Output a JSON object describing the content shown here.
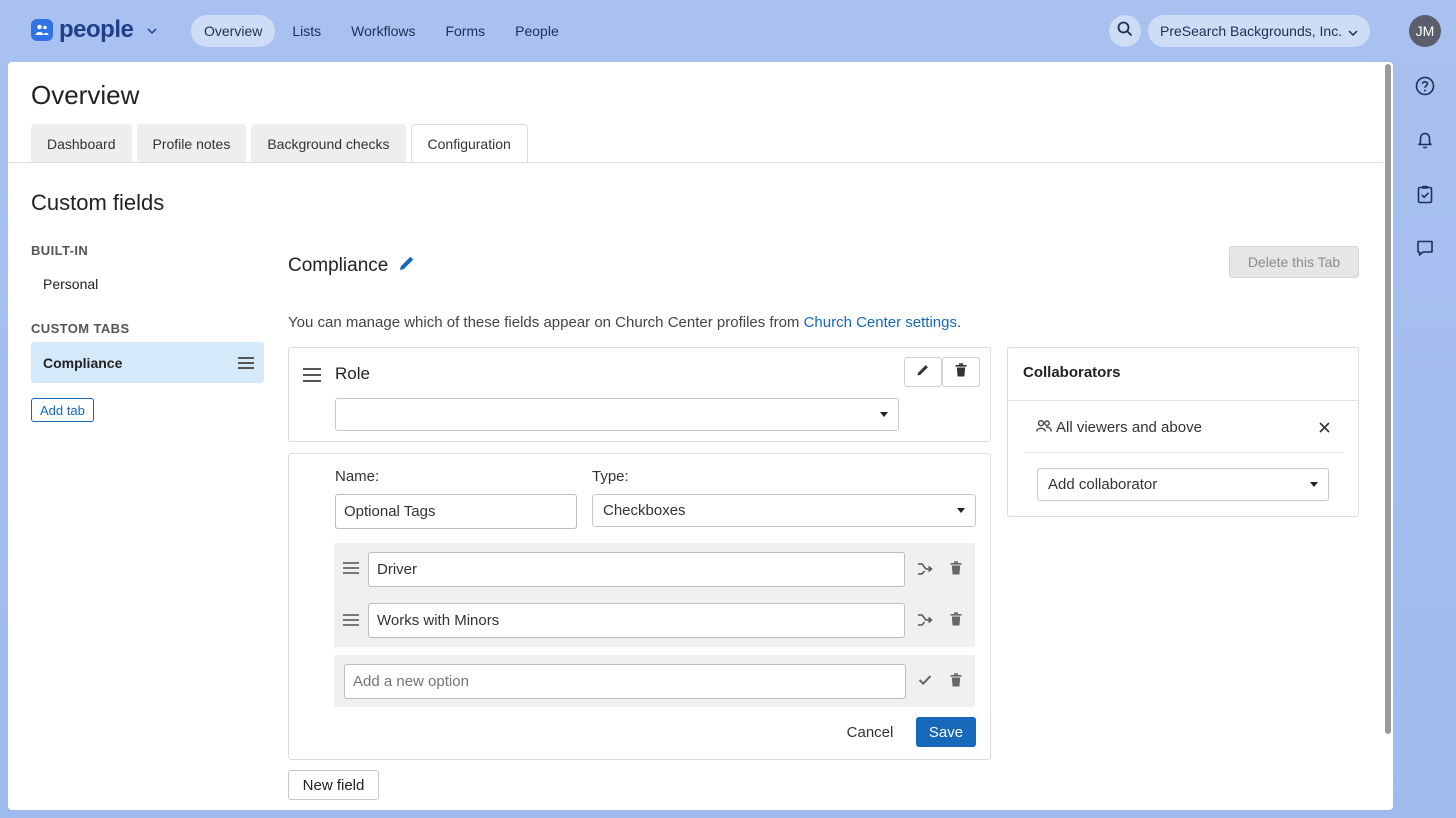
{
  "app": {
    "name": "people"
  },
  "nav": {
    "items": [
      {
        "label": "Overview",
        "active": true
      },
      {
        "label": "Lists",
        "active": false
      },
      {
        "label": "Workflows",
        "active": false
      },
      {
        "label": "Forms",
        "active": false
      },
      {
        "label": "People",
        "active": false
      }
    ]
  },
  "org": {
    "name": "PreSearch Backgrounds, Inc."
  },
  "user": {
    "initials": "JM"
  },
  "page": {
    "title": "Overview",
    "tabs": [
      {
        "label": "Dashboard",
        "active": false
      },
      {
        "label": "Profile notes",
        "active": false
      },
      {
        "label": "Background checks",
        "active": false
      },
      {
        "label": "Configuration",
        "active": true
      }
    ]
  },
  "custom_fields": {
    "title": "Custom fields",
    "built_in_heading": "BUILT-IN",
    "built_in_items": [
      "Personal"
    ],
    "custom_tabs_heading": "CUSTOM TABS",
    "custom_tabs": [
      "Compliance"
    ],
    "add_tab_label": "Add tab"
  },
  "tab_detail": {
    "title": "Compliance",
    "delete_label": "Delete this Tab",
    "info_text": "You can manage which of these fields appear on Church Center profiles from ",
    "info_link": "Church Center settings",
    "info_suffix": "."
  },
  "role_field": {
    "name": "Role",
    "select_value": ""
  },
  "edit_field": {
    "name_label": "Name:",
    "name_value": "Optional Tags",
    "type_label": "Type:",
    "type_value": "Checkboxes",
    "options": [
      "Driver",
      "Works with Minors"
    ],
    "new_option_placeholder": "Add a new option",
    "cancel_label": "Cancel",
    "save_label": "Save"
  },
  "new_field_label": "New field",
  "collaborators": {
    "title": "Collaborators",
    "items": [
      "All viewers and above"
    ],
    "add_placeholder": "Add collaborator"
  },
  "colors": {
    "accent": "#1668b8",
    "active_tab_bg": "#d4eafb",
    "background": "#a6bff0"
  }
}
